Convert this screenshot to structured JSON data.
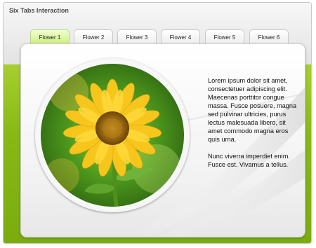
{
  "app": {
    "title": "Six Tabs Interaction"
  },
  "tabs": [
    {
      "label": "Flower 1",
      "active": true
    },
    {
      "label": "Flower 2",
      "active": false
    },
    {
      "label": "Flower 3",
      "active": false
    },
    {
      "label": "Flower 4",
      "active": false
    },
    {
      "label": "Flower 5",
      "active": false
    },
    {
      "label": "Flower 6",
      "active": false
    }
  ],
  "content": {
    "paragraph1": "Lorem ipsum dolor sit amet, consectetuer adipiscing elit. Maecenas porttitor congue massa. Fusce posuere, magna sed pulvinar ultricies, purus lectus malesuada libero, sit amet commodo magna eros quis urna.",
    "paragraph2": "Nunc viverra imperdiet enim. Fusce est. Vivamus a tellus."
  },
  "colors": {
    "accent_green": "#86b915",
    "active_tab": "#c9ef7a"
  }
}
